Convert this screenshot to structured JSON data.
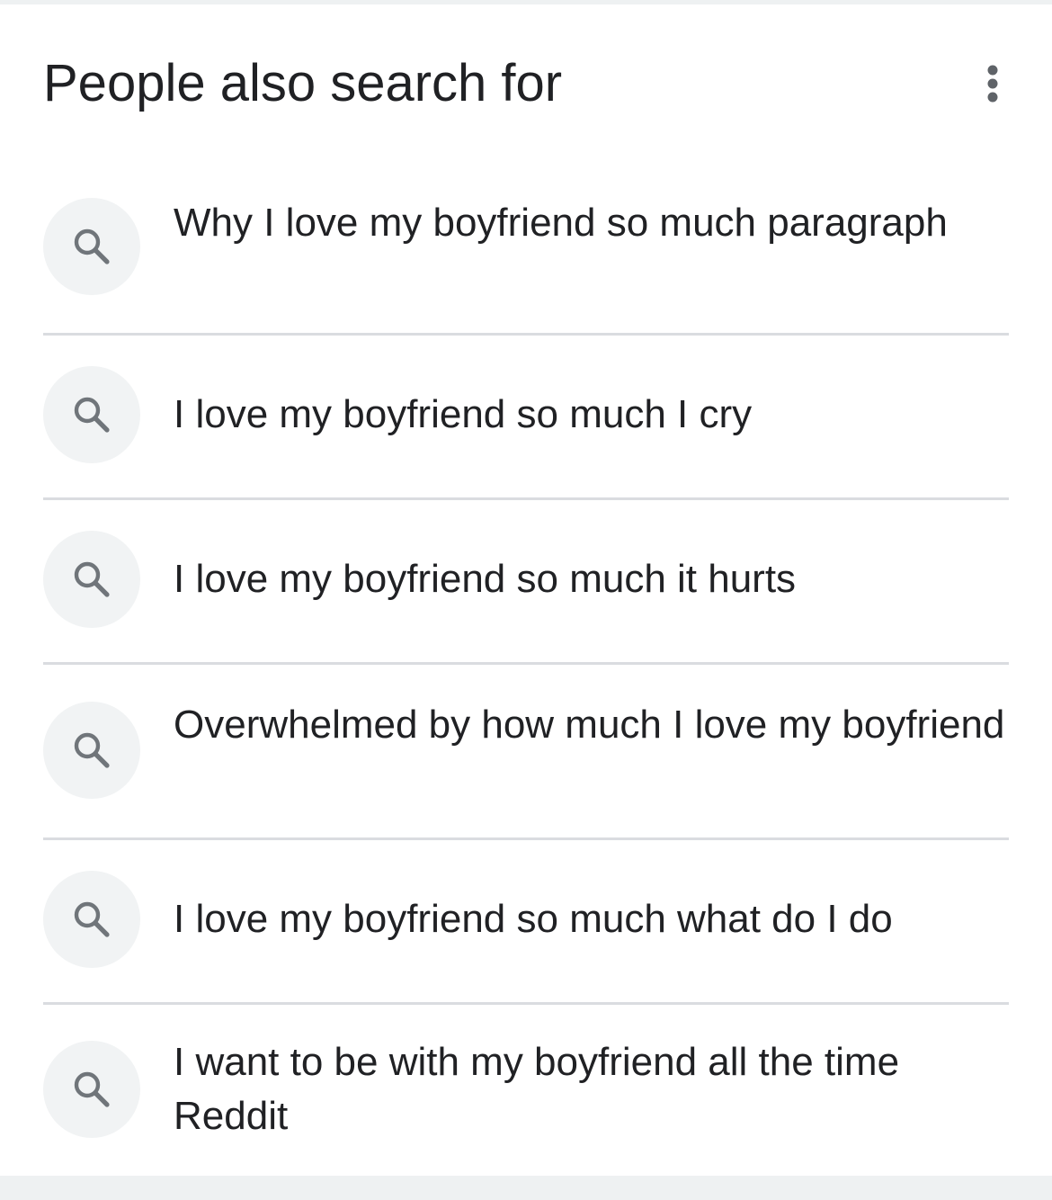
{
  "header": {
    "title": "People also search for",
    "more_icon": "more-vert-icon"
  },
  "items": [
    {
      "label": "Why I love my boyfriend so much paragraph",
      "icon": "search-icon"
    },
    {
      "label": "I love my boyfriend so much I cry",
      "icon": "search-icon"
    },
    {
      "label": "I love my boyfriend so much it hurts",
      "icon": "search-icon"
    },
    {
      "label": "Overwhelmed by how much I love my boyfriend",
      "icon": "search-icon"
    },
    {
      "label": "I love my boyfriend so much what do I do",
      "icon": "search-icon"
    },
    {
      "label": "I want to be with my boyfriend all the time Reddit",
      "icon": "search-icon"
    }
  ],
  "colors": {
    "text": "#202124",
    "icon": "#70757a",
    "icon_bg": "#f1f3f4",
    "divider": "#dadce0",
    "page_bg": "#eef1f2"
  }
}
